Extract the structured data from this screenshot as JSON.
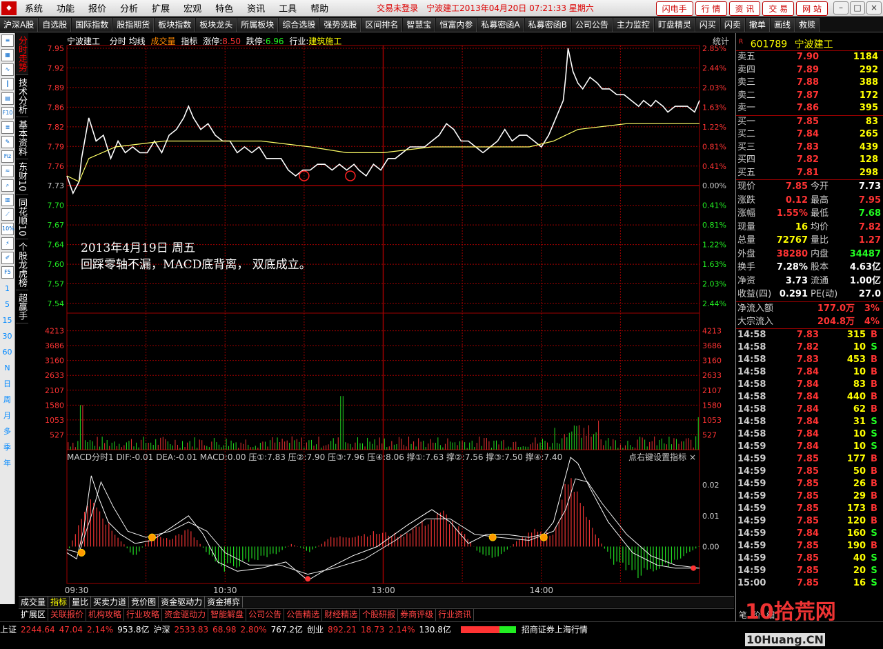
{
  "menubar": {
    "items": [
      "系统",
      "功能",
      "报价",
      "分析",
      "扩展",
      "宏观",
      "特色",
      "资讯",
      "工具",
      "帮助"
    ],
    "status": "交易未登录",
    "title": "宁波建工2013年04月20日  07:21:33  星期六",
    "right_buttons": [
      "闪电手",
      "行 情",
      "资 讯",
      "交 易",
      "网 站"
    ],
    "window_buttons": [
      "–",
      "□",
      "×"
    ]
  },
  "toolbar": {
    "items": [
      "沪深A股",
      "自选股",
      "国际指数",
      "股指期货",
      "板块指数",
      "板块龙头",
      "所属板块",
      "综合选股",
      "强势选股",
      "区间排名",
      "智慧宝",
      "恒富内参",
      "私募密函A",
      "私募密函B",
      "公司公告",
      "主力监控",
      "盯盘精灵",
      "闪买",
      "闪卖",
      "撤单",
      "画线",
      "救赎"
    ]
  },
  "leftbar": {
    "periods": [
      "1",
      "5",
      "15",
      "30",
      "60",
      "N",
      "日",
      "周",
      "月",
      "多",
      "季",
      "年"
    ],
    "icons": [
      "list-icon",
      "grid-icon",
      "line-chart-icon",
      "candlestick-icon",
      "table-icon",
      "f10-icon",
      "doc-icon",
      "note-icon",
      "f-icon",
      "flow-icon",
      "search-icon",
      "chart-icon",
      "graph-icon",
      "percent-icon",
      "bolt-icon",
      "pencil-icon",
      "f5-icon"
    ],
    "icon_labels": [
      "F10",
      "Fiz",
      "10%",
      "F5"
    ]
  },
  "sidetabs": [
    "分时走势",
    "技术分析",
    "基本资料",
    "东财10",
    "同花顺10",
    "个股龙虎榜",
    "超赢手"
  ],
  "chart": {
    "stock_name": "宁波建工",
    "indicators_label": "分时  均线",
    "volume_label": "成交量",
    "indicator_label": "指标",
    "limit_up_label": "涨停:",
    "limit_up": "8.50",
    "limit_down_label": "跌停:",
    "limit_down": "6.96",
    "industry_label": "行业:",
    "industry": "建筑施工",
    "stat_label": "统计",
    "macd_info": "MACD分时1  DIF:-0.01  DEA:-0.01  MACD:0.00  压①:7.83  压②:7.90  压③:7.96  压④:8.06  撑①:7.63  撑②:7.56  撑③:7.50  撑④:7.40",
    "macd_hint": "点右键设置指标  ×",
    "annotation_line1": "2013年4月19日  周五",
    "annotation_line2": "回踩零轴不漏，MACD底背离， 双底成立。",
    "x_ticks": [
      "09:30",
      "10:30",
      "13:00",
      "14:00"
    ]
  },
  "chart_data": [
    {
      "type": "line",
      "title": "",
      "x": [
        "09:30",
        "10:30",
        "11:30/13:00",
        "14:00",
        "15:00"
      ],
      "xlabel": "",
      "ylabel": "",
      "ylim": [
        7.51,
        7.95
      ],
      "y_ticks": [
        "7.95",
        "7.92",
        "7.89",
        "7.86",
        "7.82",
        "7.79",
        "7.76",
        "7.73",
        "7.70",
        "7.67",
        "7.64",
        "7.60",
        "7.57",
        "7.54"
      ],
      "pct_ticks": [
        "2.85%",
        "2.44%",
        "2.03%",
        "1.63%",
        "1.22%",
        "0.81%",
        "0.41%",
        "0.00%",
        "0.41%",
        "0.81%",
        "1.22%",
        "1.63%",
        "2.03%",
        "2.44%"
      ],
      "prev_close": 7.73,
      "series": [
        {
          "name": "分时",
          "color": "#ffffff",
          "points": [
            [
              0,
              7.73
            ],
            [
              5,
              7.7
            ],
            [
              10,
              7.72
            ],
            [
              12,
              7.76
            ],
            [
              18,
              7.83
            ],
            [
              24,
              7.79
            ],
            [
              30,
              7.8
            ],
            [
              36,
              7.76
            ],
            [
              42,
              7.79
            ],
            [
              48,
              7.77
            ],
            [
              54,
              7.78
            ],
            [
              60,
              7.77
            ],
            [
              66,
              7.77
            ],
            [
              72,
              7.79
            ],
            [
              78,
              7.77
            ],
            [
              84,
              7.8
            ],
            [
              90,
              7.81
            ],
            [
              96,
              7.83
            ],
            [
              100,
              7.85
            ],
            [
              104,
              7.83
            ],
            [
              110,
              7.81
            ],
            [
              116,
              7.82
            ],
            [
              122,
              7.8
            ],
            [
              128,
              7.79
            ],
            [
              134,
              7.79
            ],
            [
              140,
              7.77
            ],
            [
              146,
              7.78
            ],
            [
              152,
              7.77
            ],
            [
              158,
              7.78
            ],
            [
              164,
              7.76
            ],
            [
              170,
              7.76
            ],
            [
              176,
              7.76
            ],
            [
              182,
              7.74
            ],
            [
              188,
              7.73
            ],
            [
              194,
              7.74
            ],
            [
              200,
              7.74
            ],
            [
              206,
              7.75
            ],
            [
              212,
              7.75
            ],
            [
              218,
              7.74
            ],
            [
              224,
              7.75
            ],
            [
              230,
              7.74
            ],
            [
              236,
              7.75
            ],
            [
              240,
              7.74
            ],
            [
              246,
              7.73
            ],
            [
              252,
              7.75
            ],
            [
              258,
              7.74
            ],
            [
              264,
              7.76
            ],
            [
              270,
              7.76
            ],
            [
              276,
              7.77
            ],
            [
              282,
              7.78
            ],
            [
              288,
              7.78
            ],
            [
              294,
              7.78
            ],
            [
              300,
              7.79
            ],
            [
              306,
              7.8
            ],
            [
              312,
              7.82
            ],
            [
              318,
              7.81
            ],
            [
              324,
              7.79
            ],
            [
              330,
              7.79
            ],
            [
              336,
              7.78
            ],
            [
              342,
              7.77
            ],
            [
              348,
              7.78
            ],
            [
              354,
              7.79
            ],
            [
              360,
              7.81
            ],
            [
              366,
              7.79
            ],
            [
              372,
              7.8
            ],
            [
              378,
              7.8
            ],
            [
              384,
              7.79
            ],
            [
              390,
              7.78
            ],
            [
              396,
              7.8
            ],
            [
              402,
              7.83
            ],
            [
              408,
              7.86
            ],
            [
              410,
              7.9
            ],
            [
              412,
              7.95
            ],
            [
              416,
              7.91
            ],
            [
              420,
              7.89
            ],
            [
              424,
              7.88
            ],
            [
              430,
              7.9
            ],
            [
              436,
              7.89
            ],
            [
              440,
              7.88
            ],
            [
              446,
              7.88
            ],
            [
              452,
              7.87
            ],
            [
              458,
              7.87
            ],
            [
              464,
              7.86
            ],
            [
              470,
              7.85
            ],
            [
              474,
              7.86
            ],
            [
              480,
              7.85
            ],
            [
              484,
              7.86
            ],
            [
              490,
              7.85
            ],
            [
              494,
              7.84
            ],
            [
              500,
              7.85
            ],
            [
              504,
              7.85
            ],
            [
              510,
              7.85
            ],
            [
              516,
              7.84
            ],
            [
              518,
              7.85
            ],
            [
              520,
              7.86
            ]
          ]
        },
        {
          "name": "均线",
          "color": "#ffff66",
          "points": [
            [
              0,
              7.73
            ],
            [
              10,
              7.72
            ],
            [
              18,
              7.76
            ],
            [
              40,
              7.78
            ],
            [
              80,
              7.79
            ],
            [
              120,
              7.79
            ],
            [
              160,
              7.79
            ],
            [
              200,
              7.78
            ],
            [
              230,
              7.77
            ],
            [
              260,
              7.77
            ],
            [
              300,
              7.78
            ],
            [
              340,
              7.78
            ],
            [
              380,
              7.78
            ],
            [
              400,
              7.79
            ],
            [
              410,
              7.8
            ],
            [
              420,
              7.81
            ],
            [
              460,
              7.82
            ],
            [
              520,
              7.82
            ]
          ]
        }
      ],
      "annotations": [
        {
          "x": 195,
          "y": 7.73,
          "shape": "circle"
        },
        {
          "x": 233,
          "y": 7.73,
          "shape": "circle"
        }
      ]
    },
    {
      "type": "bar",
      "title": "成交量",
      "y_ticks": [
        "4213",
        "3686",
        "3160",
        "2633",
        "2107",
        "1580",
        "1053",
        "527"
      ],
      "ylim": [
        0,
        4740
      ],
      "spikes": [
        {
          "x": 12,
          "value": 1580
        },
        {
          "x": 226,
          "value": 1900
        },
        {
          "x": 408,
          "value": 3250
        },
        {
          "x": 412,
          "value": 3800
        },
        {
          "x": 416,
          "value": 2850
        },
        {
          "x": 520,
          "value": 1150
        }
      ]
    },
    {
      "type": "bar",
      "title": "MACD分时1",
      "y_ticks": [
        "0.02",
        "0.01",
        "0.00"
      ],
      "ylim": [
        -0.012,
        0.027
      ]
    }
  ],
  "bottom_tabs": [
    "成交量",
    "指标",
    "量比",
    "买卖力道",
    "竞价图",
    "资金驱动力",
    "资金搏弈"
  ],
  "bottom_tabs_active": 1,
  "ext_tabs": [
    "扩展区",
    "关联报价",
    "机构攻略",
    "行业攻略",
    "资金驱动力",
    "智能解盘",
    "公司公告",
    "公告精选",
    "财经精选",
    "个股研报",
    "券商评级",
    "行业资讯"
  ],
  "status_bar": {
    "items": [
      {
        "label": "上证",
        "value": "2244.64",
        "change": "47.04",
        "pct": "2.14%",
        "amount": "953.8亿"
      },
      {
        "label": "沪深",
        "value": "2533.83",
        "change": "68.98",
        "pct": "2.80%",
        "amount": "767.2亿"
      },
      {
        "label": "创业",
        "value": "892.21",
        "change": "18.73",
        "pct": "2.14%",
        "amount": "130.8亿"
      }
    ],
    "broker": "招商证券上海行情"
  },
  "right_panel": {
    "code_badge": "R",
    "code": "601789",
    "name": "宁波建工",
    "asks": [
      {
        "label": "卖五",
        "price": "7.90",
        "vol": "1184"
      },
      {
        "label": "卖四",
        "price": "7.89",
        "vol": "292"
      },
      {
        "label": "卖三",
        "price": "7.88",
        "vol": "388"
      },
      {
        "label": "卖二",
        "price": "7.87",
        "vol": "172"
      },
      {
        "label": "卖一",
        "price": "7.86",
        "vol": "395"
      }
    ],
    "bids": [
      {
        "label": "买一",
        "price": "7.85",
        "vol": "83"
      },
      {
        "label": "买二",
        "price": "7.84",
        "vol": "265"
      },
      {
        "label": "买三",
        "price": "7.83",
        "vol": "439"
      },
      {
        "label": "买四",
        "price": "7.82",
        "vol": "128"
      },
      {
        "label": "买五",
        "price": "7.81",
        "vol": "298"
      }
    ],
    "quotes": [
      {
        "l1": "现价",
        "v1": "7.85",
        "c1": "red",
        "l2": "今开",
        "v2": "7.73",
        "c2": "wht"
      },
      {
        "l1": "涨跌",
        "v1": "0.12",
        "c1": "red",
        "l2": "最高",
        "v2": "7.95",
        "c2": "red"
      },
      {
        "l1": "涨幅",
        "v1": "1.55%",
        "c1": "red",
        "l2": "最低",
        "v2": "7.68",
        "c2": "grn"
      },
      {
        "l1": "现量",
        "v1": "16",
        "c1": "yel",
        "l2": "均价",
        "v2": "7.82",
        "c2": "red"
      },
      {
        "l1": "总量",
        "v1": "72767",
        "c1": "yel",
        "l2": "量比",
        "v2": "1.27",
        "c2": "red"
      },
      {
        "l1": "外盘",
        "v1": "38280",
        "c1": "red",
        "l2": "内盘",
        "v2": "34487",
        "c2": "grn"
      },
      {
        "l1": "换手",
        "v1": "7.28%",
        "c1": "wht",
        "l2": "股本",
        "v2": "4.63亿",
        "c2": "wht"
      },
      {
        "l1": "净资",
        "v1": "3.73",
        "c1": "wht",
        "l2": "流通",
        "v2": "1.00亿",
        "c2": "wht"
      },
      {
        "l1": "收益(四)",
        "v1": "0.291",
        "c1": "wht",
        "l2": "PE(动)",
        "v2": "27.0",
        "c2": "wht"
      }
    ],
    "flows": [
      {
        "label": "净流入额",
        "value": "177.0万",
        "pct": "3%"
      },
      {
        "label": "大宗流入",
        "value": "204.8万",
        "pct": "4%"
      }
    ],
    "ticks": [
      {
        "t": "14:58",
        "p": "7.83",
        "v": "315",
        "bs": "B"
      },
      {
        "t": "14:58",
        "p": "7.82",
        "v": "10",
        "bs": "S"
      },
      {
        "t": "14:58",
        "p": "7.83",
        "v": "453",
        "bs": "B"
      },
      {
        "t": "14:58",
        "p": "7.84",
        "v": "10",
        "bs": "B"
      },
      {
        "t": "14:58",
        "p": "7.84",
        "v": "83",
        "bs": "B"
      },
      {
        "t": "14:58",
        "p": "7.84",
        "v": "440",
        "bs": "B"
      },
      {
        "t": "14:58",
        "p": "7.84",
        "v": "62",
        "bs": "B"
      },
      {
        "t": "14:58",
        "p": "7.84",
        "v": "31",
        "bs": "S"
      },
      {
        "t": "14:58",
        "p": "7.84",
        "v": "10",
        "bs": "S"
      },
      {
        "t": "14:59",
        "p": "7.84",
        "v": "10",
        "bs": "S"
      },
      {
        "t": "14:59",
        "p": "7.85",
        "v": "177",
        "bs": "B"
      },
      {
        "t": "14:59",
        "p": "7.85",
        "v": "50",
        "bs": "B"
      },
      {
        "t": "14:59",
        "p": "7.85",
        "v": "26",
        "bs": "B"
      },
      {
        "t": "14:59",
        "p": "7.85",
        "v": "29",
        "bs": "B"
      },
      {
        "t": "14:59",
        "p": "7.85",
        "v": "173",
        "bs": "B"
      },
      {
        "t": "14:59",
        "p": "7.85",
        "v": "120",
        "bs": "B"
      },
      {
        "t": "14:59",
        "p": "7.84",
        "v": "160",
        "bs": "S"
      },
      {
        "t": "14:59",
        "p": "7.85",
        "v": "190",
        "bs": "B"
      },
      {
        "t": "14:59",
        "p": "7.85",
        "v": "40",
        "bs": "S"
      },
      {
        "t": "14:59",
        "p": "7.85",
        "v": "20",
        "bs": "S"
      },
      {
        "t": "15:00",
        "p": "7.85",
        "v": "16",
        "bs": "S"
      }
    ],
    "footer_tabs": [
      "笔",
      "价",
      "细"
    ]
  },
  "watermark": {
    "text": "10拾荒网",
    "sub": "10Huang.CN"
  },
  "colors": {
    "up": "#ff3333",
    "down": "#22ee22",
    "grid": "#a00000",
    "price": "#ffffff",
    "avg": "#ffff66"
  }
}
